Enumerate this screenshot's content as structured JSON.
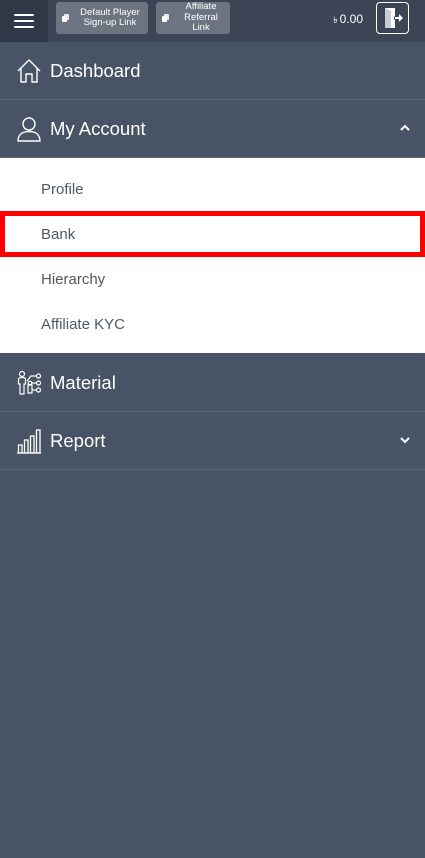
{
  "topbar": {
    "menu_icon": "hamburger-icon",
    "player_link_label": "Default Player Sign-up Link",
    "affiliate_link_label": "Affiliate Referral Link",
    "copy_icon": "copy-icon",
    "currency_symbol": "৳",
    "balance": "0.00",
    "logout_icon": "logout-icon"
  },
  "nav": {
    "dashboard": {
      "label": "Dashboard",
      "icon": "home-icon"
    },
    "my_account": {
      "label": "My Account",
      "icon": "user-icon",
      "expanded": true,
      "items": [
        "Profile",
        "Bank",
        "Hierarchy",
        "Affiliate KYC"
      ],
      "highlighted_item": "Bank"
    },
    "material": {
      "label": "Material",
      "icon": "material-icon"
    },
    "report": {
      "label": "Report",
      "icon": "bar-chart-icon",
      "expanded": false
    }
  },
  "colors": {
    "background": "#485365",
    "topbar": "#3b4556",
    "highlight": "#ff0000",
    "submenu_bg": "#ffffff",
    "submenu_text": "#505866"
  }
}
